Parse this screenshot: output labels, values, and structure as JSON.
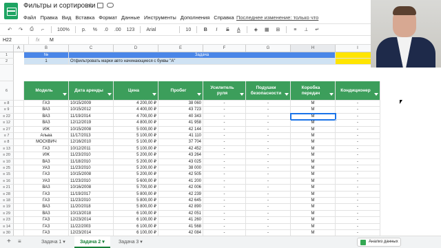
{
  "app": {
    "title": "Фильтры и сортировки",
    "last_edit": "Последнее изменение: только что"
  },
  "menu": [
    "Файл",
    "Правка",
    "Вид",
    "Вставка",
    "Формат",
    "Данные",
    "Инструменты",
    "Дополнения",
    "Справка"
  ],
  "toolbar": {
    "zoom": "100%",
    "currency": "р.",
    "percent": "%",
    ".0": ".0",
    ".00": ".00",
    "numfmt": "123",
    "font": "Arial",
    "size": "10",
    "bold": "B",
    "italic": "I",
    "strike": "S",
    "color": "A"
  },
  "formula_bar": {
    "cell_ref": "H22",
    "fx": "fx",
    "value": "М"
  },
  "columns": [
    "A",
    "B",
    "C",
    "D",
    "E",
    "F",
    "G",
    "H",
    "I"
  ],
  "task_header": {
    "num": "№",
    "task": "Задача",
    "row_num": "1",
    "row_task": "Отфильтровать марки авто начинающиеся с буквы \"А\""
  },
  "table_headers": [
    "Модель",
    "Дата аренды",
    "Цена",
    "Пробег",
    "Усилитель руля",
    "Подушки безопасности",
    "Коробка передач",
    "Кондиционер"
  ],
  "row_numbers": [
    "1",
    "2",
    "",
    "",
    "6",
    "9",
    "11",
    "22",
    "12",
    "27",
    "7",
    "8",
    "13",
    "20",
    "10",
    "25",
    "15",
    "16",
    "21",
    "28",
    "18",
    "19",
    "29",
    "23",
    "14",
    "30",
    "17",
    "24",
    "26",
    "9"
  ],
  "rows": [
    [
      "ГАЗ",
      "10/15/2009",
      "4 200,00 ₽",
      "38 060",
      "-",
      "-",
      "М",
      "-"
    ],
    [
      "ВАЗ",
      "10/15/2012",
      "4 400,00 ₽",
      "43 723",
      "-",
      "-",
      "М",
      "-"
    ],
    [
      "ВАЗ",
      "11/19/2014",
      "4 700,00 ₽",
      "40 343",
      "-",
      "-",
      "М",
      "-"
    ],
    [
      "ВАЗ",
      "12/12/2019",
      "4 800,00 ₽",
      "41 958",
      "-",
      "-",
      "М",
      "-"
    ],
    [
      "ИЖ",
      "10/15/2008",
      "5 000,00 ₽",
      "42 144",
      "-",
      "-",
      "М",
      "-"
    ],
    [
      "Альва",
      "11/17/2013",
      "5 100,00 ₽",
      "41 110",
      "-",
      "-",
      "М",
      "-"
    ],
    [
      "МОСКВИЧ",
      "12/16/2010",
      "5 100,00 ₽",
      "37 704",
      "-",
      "-",
      "М",
      "-"
    ],
    [
      "ГАЗ",
      "10/12/2011",
      "5 100,00 ₽",
      "42 452",
      "-",
      "-",
      "М",
      "-"
    ],
    [
      "ИЖ",
      "11/23/2010",
      "5 200,00 ₽",
      "43 264",
      "-",
      "-",
      "М",
      "-"
    ],
    [
      "ВАЗ",
      "11/18/2010",
      "5 200,00 ₽",
      "43 025",
      "-",
      "-",
      "М",
      "-"
    ],
    [
      "УАЗ",
      "11/23/2010",
      "5 200,00 ₽",
      "38 000",
      "-",
      "-",
      "М",
      "-"
    ],
    [
      "ГАЗ",
      "10/15/2008",
      "5 200,00 ₽",
      "42 505",
      "-",
      "-",
      "М",
      "-"
    ],
    [
      "УАЗ",
      "11/23/2010",
      "5 600,00 ₽",
      "41 200",
      "-",
      "-",
      "М",
      "-"
    ],
    [
      "ВАЗ",
      "10/16/2008",
      "5 700,00 ₽",
      "42 006",
      "-",
      "-",
      "М",
      "-"
    ],
    [
      "ГАЗ",
      "11/19/2017",
      "5 800,00 ₽",
      "42 239",
      "-",
      "-",
      "М",
      "-"
    ],
    [
      "ГАЗ",
      "11/23/2010",
      "5 800,00 ₽",
      "42 645",
      "-",
      "-",
      "М",
      "-"
    ],
    [
      "ВАЗ",
      "11/20/2018",
      "5 800,00 ₽",
      "42 890",
      "-",
      "-",
      "М",
      "-"
    ],
    [
      "ВАЗ",
      "10/13/2018",
      "6 100,00 ₽",
      "42 051",
      "-",
      "-",
      "М",
      "-"
    ],
    [
      "ГАЗ",
      "12/23/2014",
      "6 100,00 ₽",
      "41 260",
      "-",
      "-",
      "М",
      "-"
    ],
    [
      "ГАЗ",
      "11/22/2003",
      "6 100,00 ₽",
      "41 568",
      "-",
      "-",
      "М",
      "-"
    ],
    [
      "ГАЗ",
      "12/23/2014",
      "6 100,00 ₽",
      "42 084",
      "-",
      "-",
      "М",
      "-"
    ]
  ],
  "visible_row_labels": [
    "8",
    "9",
    "22",
    "12",
    "27",
    "7",
    "8",
    "13",
    "20",
    "10",
    "25",
    "15",
    "16",
    "21",
    "28",
    "18",
    "19",
    "29",
    "23",
    "14",
    "30"
  ],
  "tabs": [
    "Задача 1",
    "Задача 2",
    "Задача 3"
  ],
  "explore": "Анализ данных"
}
